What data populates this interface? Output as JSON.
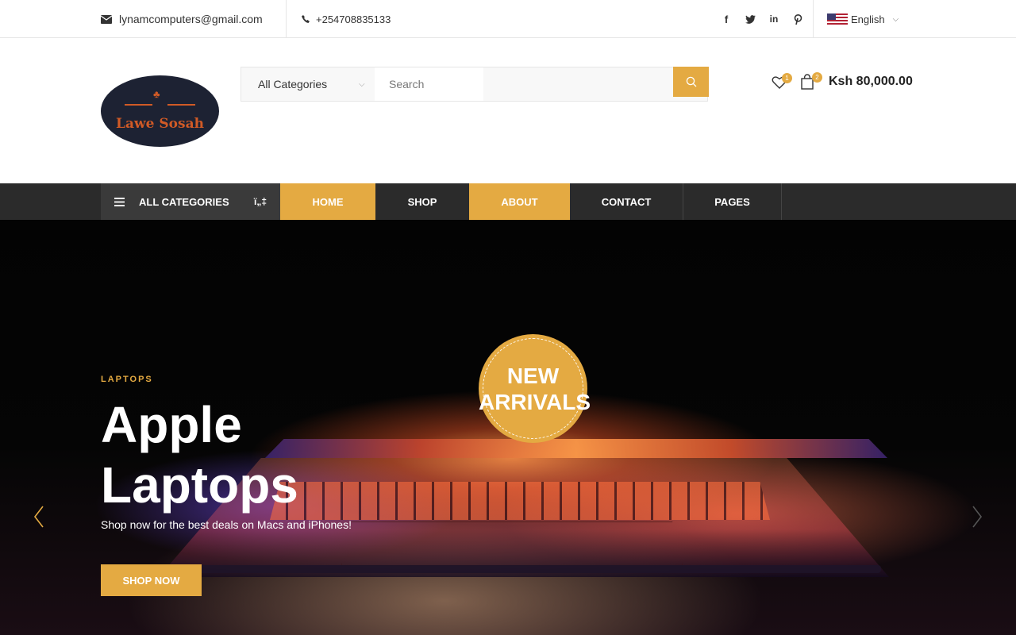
{
  "topbar": {
    "email": "lynamcomputers@gmail.com",
    "phone": "+254708835133",
    "socials": [
      "facebook-icon",
      "twitter-icon",
      "linkedin-icon",
      "pinterest-icon"
    ],
    "language": "English"
  },
  "header": {
    "logo_text": "Lawe Sosah",
    "search": {
      "category": "All Categories",
      "placeholder": "Search"
    },
    "wishlist_count": "1",
    "cart_count": "2",
    "cart_total": "Ksh 80,000.00"
  },
  "nav": {
    "all_categories": "ALL CATEGORIES",
    "items": [
      {
        "label": "HOME",
        "active": true
      },
      {
        "label": "SHOP",
        "active": false
      },
      {
        "label": "ABOUT",
        "active": true
      },
      {
        "label": "CONTACT",
        "active": false
      },
      {
        "label": "PAGES",
        "active": false
      }
    ]
  },
  "hero": {
    "eyebrow": "LAPTOPS",
    "title_line1": "Apple",
    "title_line2": "Laptops",
    "subtitle": "Shop now for the best deals on Macs and iPhones!",
    "cta": "SHOP NOW",
    "badge_line1": "NEW",
    "badge_line2": "ARRIVALS"
  },
  "colors": {
    "accent": "#e4aa42",
    "nav_bg": "#2b2b2b",
    "logo_bg": "#1d2233",
    "logo_text": "#d05a26"
  }
}
